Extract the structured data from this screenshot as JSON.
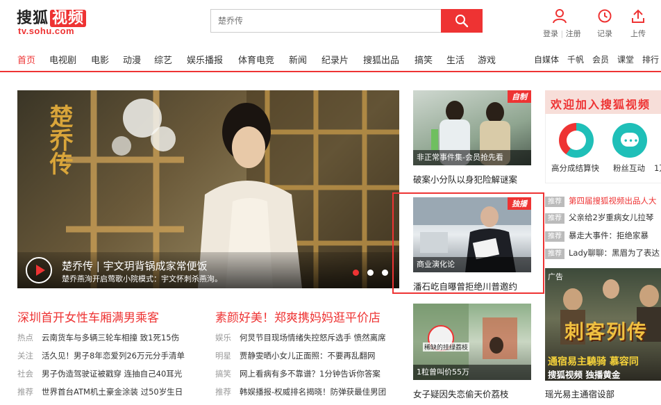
{
  "header": {
    "logo_text": "搜狐",
    "logo_highlight": "视频",
    "logo_url": "tv.sohu.com",
    "search_placeholder": "楚乔传",
    "login_label": "登录",
    "divider": "|",
    "register_label": "注册",
    "history_label": "记录",
    "upload_label": "上传"
  },
  "nav": {
    "items": [
      "首页",
      "电视剧",
      "电影",
      "动漫",
      "综艺",
      "娱乐播报",
      "体育电竞",
      "新闻",
      "纪录片",
      "搜狐出品",
      "搞笑",
      "生活",
      "游戏"
    ],
    "right_items": [
      "自媒体",
      "千帆",
      "会员",
      "课堂",
      "排行"
    ]
  },
  "hero": {
    "poster_title": "楚乔传",
    "title": "楚乔传 | 宇文玥背锅成家常便饭",
    "subtitle": "楚乔燕洵开启莺歌小院模式：宇文怀刺杀燕洵。"
  },
  "cards": [
    {
      "caption": "非正常事件集-会员抢先看",
      "tag": "自制",
      "title": "破案小分队以身犯险解谜案"
    },
    {
      "caption": "商业演化论",
      "tag": "独播",
      "title": "潘石屹自曝曾拒绝川普邀约"
    },
    {
      "caption": "1粒曾叫价55万",
      "overlay": "稀缺的挂绿荔枝",
      "title": "女子疑因失恋偷天价荔枝"
    }
  ],
  "headlines": {
    "left": "深圳首开女性车厢满男乘客",
    "right": "素颜好美！郑爽携妈妈逛平价店"
  },
  "news_left": [
    {
      "cat": "热点",
      "text": "云南货车与多辆三轮车相撞 致1死15伤"
    },
    {
      "cat": "关注",
      "text": "活久见！男子8年恋爱列26万元分手清单"
    },
    {
      "cat": "社会",
      "text": "男子伪造驾驶证被戳穿 连抽自己40耳光"
    },
    {
      "cat": "推荐",
      "text": "世界首台ATM机土豪金涂装 过50岁生日"
    }
  ],
  "news_right": [
    {
      "cat": "娱乐",
      "text": "何炅节目现场情绪失控怒斥选手 愤然离席"
    },
    {
      "cat": "明星",
      "text": "贾静雯晒小女儿正面照：不要再乱翻网"
    },
    {
      "cat": "搞笑",
      "text": "网上看病有多不靠谱？1分钟告诉你答案"
    },
    {
      "cat": "推荐",
      "text": "韩娱播报-权威排名揭晓！防弹获最佳男团"
    }
  ],
  "sidebar": {
    "banner": "欢迎加入搜狐视频",
    "icon1_label": "高分成结算快",
    "icon2_label": "粉丝互动",
    "icon3_label": "1万",
    "items": [
      {
        "badge": "推荐",
        "text": "第四届搜狐视频出品人大",
        "hot": true
      },
      {
        "badge": "推荐",
        "text": "父亲给2岁重病女儿拉琴",
        "hot": false
      },
      {
        "badge": "推荐",
        "text": "暴走大事件：拒绝家暴",
        "hot": false
      },
      {
        "badge": "推荐",
        "text": "Lady聊聊：黑眉为了表达",
        "hot": false
      }
    ],
    "ad_label": "广告",
    "ad_title": "刺客列传",
    "ad_slogan": "通宿易主驍骑 慕容同",
    "ad_brand": "搜狐视频 独播黄金",
    "ad_caption": "瑶光易主通宿设部"
  }
}
